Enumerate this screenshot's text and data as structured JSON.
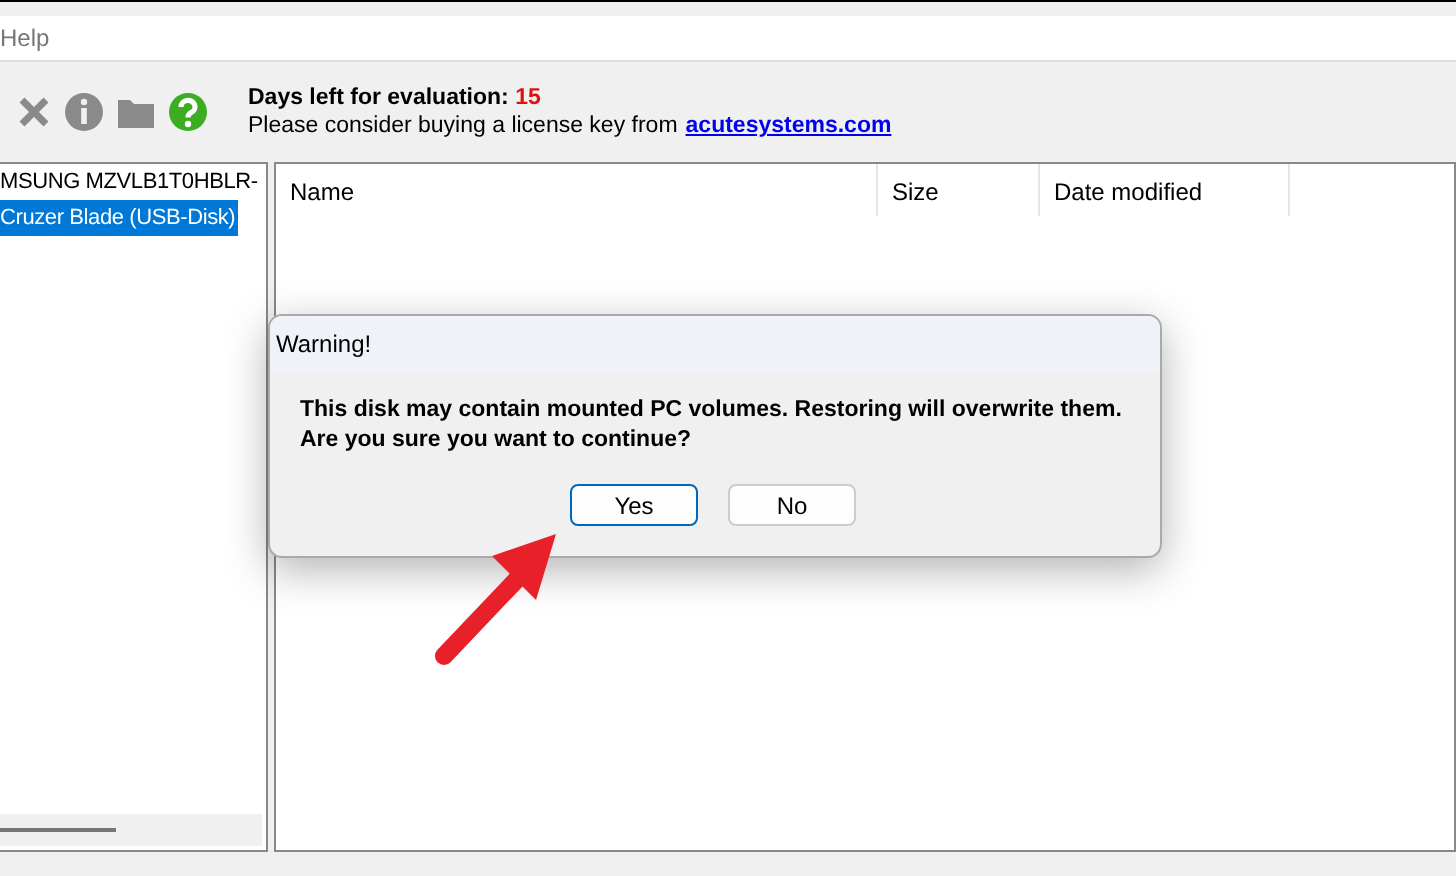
{
  "menu": [
    {
      "label": "Help"
    }
  ],
  "toolbar": {
    "tools": [
      {
        "kind": "close",
        "disabled": true
      },
      {
        "kind": "info",
        "disabled": true
      },
      {
        "kind": "folder",
        "disabled": true
      },
      {
        "kind": "help",
        "disabled": false
      }
    ]
  },
  "evaluation": {
    "label": "Days left for evaluation:",
    "days": "15",
    "message": "Please consider buying a license key from",
    "link": "acutesystems.com"
  },
  "disks": [
    {
      "label": "MSUNG MZVLB1T0HBLR-",
      "selected": false
    },
    {
      "label": "Cruzer Blade (USB-Disk)",
      "selected": true
    }
  ],
  "table": {
    "columns": [
      "Name",
      "Size",
      "Date modified"
    ]
  },
  "dialog": {
    "title": "Warning!",
    "message": "This disk may contain mounted PC volumes. Restoring will overwrite them.",
    "question": "Are you sure you want to continue?",
    "buttons": [
      {
        "label": "Yes",
        "selected": true
      },
      {
        "label": "No",
        "selected": false
      }
    ]
  }
}
